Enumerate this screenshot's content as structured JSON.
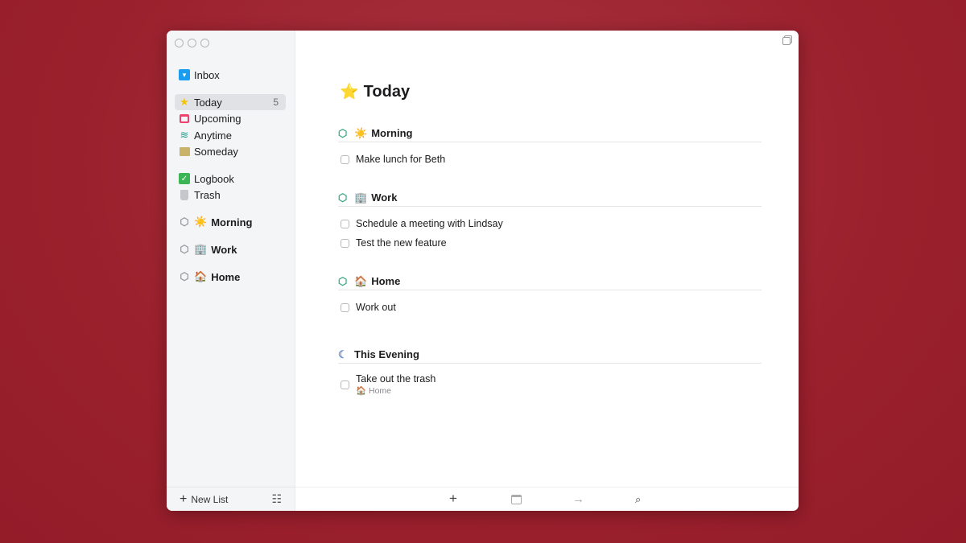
{
  "sidebar": {
    "items": [
      {
        "label": "Inbox",
        "icon": "inbox-icon"
      },
      {
        "label": "Today",
        "icon": "star-icon",
        "count": "5",
        "selected": true
      },
      {
        "label": "Upcoming",
        "icon": "calendar-icon"
      },
      {
        "label": "Anytime",
        "icon": "layers-icon"
      },
      {
        "label": "Someday",
        "icon": "archive-box-icon"
      },
      {
        "label": "Logbook",
        "icon": "logbook-icon"
      },
      {
        "label": "Trash",
        "icon": "trash-icon"
      }
    ],
    "areas": [
      {
        "emoji": "☀️",
        "label": "Morning"
      },
      {
        "emoji": "🏢",
        "label": "Work"
      },
      {
        "emoji": "🏠",
        "label": "Home"
      }
    ],
    "new_list": "New List"
  },
  "main": {
    "title": "Today",
    "title_emoji": "⭐",
    "sections": [
      {
        "emoji": "☀️",
        "label": "Morning",
        "tasks": [
          "Make lunch for Beth"
        ]
      },
      {
        "emoji": "🏢",
        "label": "Work",
        "tasks": [
          "Schedule a meeting with Lindsay",
          "Test the new feature"
        ]
      },
      {
        "emoji": "🏠",
        "label": "Home",
        "tasks": [
          "Work out"
        ]
      }
    ],
    "evening": {
      "label": "This Evening",
      "task": "Take out the trash",
      "task_area_emoji": "🏠",
      "task_area": "Home"
    }
  },
  "colors": {
    "accent_area": "#3fa98a",
    "background": "#9b202d",
    "selected": "#e1e2e6"
  }
}
